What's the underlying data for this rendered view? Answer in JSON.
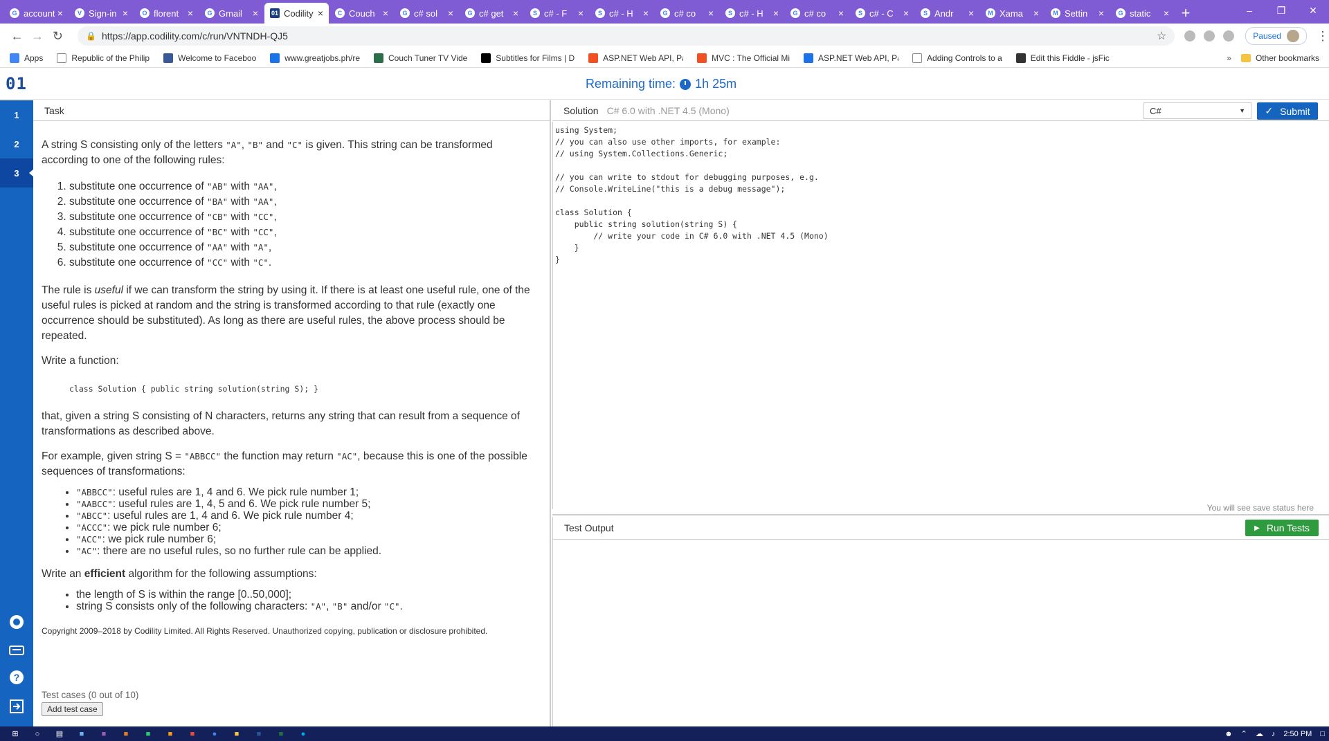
{
  "browser": {
    "tabs": [
      {
        "title": "account",
        "favicon": "G"
      },
      {
        "title": "Sign-in",
        "favicon": "V"
      },
      {
        "title": "florent",
        "favicon": "O"
      },
      {
        "title": "Gmail",
        "favicon": "G"
      },
      {
        "title": "Codility",
        "favicon": "01",
        "active": true
      },
      {
        "title": "Couch",
        "favicon": "C"
      },
      {
        "title": "c# sol",
        "favicon": "G"
      },
      {
        "title": "c# get",
        "favicon": "G"
      },
      {
        "title": "c# - F",
        "favicon": "S"
      },
      {
        "title": "c# - H",
        "favicon": "S"
      },
      {
        "title": "c# co",
        "favicon": "G"
      },
      {
        "title": "c# - H",
        "favicon": "S"
      },
      {
        "title": "c# co",
        "favicon": "G"
      },
      {
        "title": "c# - C",
        "favicon": "S"
      },
      {
        "title": "Andr",
        "favicon": "S"
      },
      {
        "title": "Xama",
        "favicon": "M"
      },
      {
        "title": "Settin",
        "favicon": "M"
      },
      {
        "title": "static",
        "favicon": "G"
      }
    ],
    "tab_close": "×",
    "new_tab": "+",
    "window_controls": {
      "minimize": "–",
      "restore": "❐",
      "close": "✕"
    },
    "nav": {
      "back": "←",
      "forward": "→",
      "reload": "↻"
    },
    "url": "https://app.codility.com/c/run/VNTNDH-QJ5",
    "star": "☆",
    "paused_label": "Paused",
    "menu": "⋮",
    "bookmarks": [
      {
        "label": "Apps",
        "color": "#4285f4"
      },
      {
        "label": "Republic of the Philip",
        "color": "#ffffff"
      },
      {
        "label": "Welcome to Faceboo",
        "color": "#3b5998"
      },
      {
        "label": "www.greatjobs.ph/re",
        "color": "#1a73e8"
      },
      {
        "label": "Couch Tuner TV Vide",
        "color": "#2c6e49"
      },
      {
        "label": "Subtitles for Films | D",
        "color": "#000000"
      },
      {
        "label": "ASP.NET Web API, Pa",
        "color": "#f25022"
      },
      {
        "label": "MVC : The Official Mi",
        "color": "#f25022"
      },
      {
        "label": "ASP.NET Web API, Pa",
        "color": "#1a73e8"
      },
      {
        "label": "Adding Controls to a",
        "color": "#ffffff"
      },
      {
        "label": "Edit this Fiddle - jsFic",
        "color": "#333333"
      }
    ],
    "bookmarks_more": "»",
    "other_bookmarks": "Other bookmarks"
  },
  "header": {
    "logo": "01",
    "remaining_label": "Remaining time:",
    "remaining_value": "1h 25m"
  },
  "sidebar": {
    "tasks": [
      "1",
      "2",
      "3"
    ],
    "active_task": "3"
  },
  "task": {
    "heading": "Task",
    "intro": "A string S consisting only of the letters \"A\", \"B\" and \"C\" is given. This string can be transformed according to one of the following rules:",
    "rules": [
      "substitute one occurrence of \"AB\" with \"AA\",",
      "substitute one occurrence of \"BA\" with \"AA\",",
      "substitute one occurrence of \"CB\" with \"CC\",",
      "substitute one occurrence of \"BC\" with \"CC\",",
      "substitute one occurrence of \"AA\" with \"A\",",
      "substitute one occurrence of \"CC\" with \"C\"."
    ],
    "useful_p1": "The rule is ",
    "useful_word": "useful",
    "useful_p2": " if we can transform the string by using it. If there is at least one useful rule, one of the useful rules is picked at random and the string is transformed according to that rule (exactly one occurrence should be substituted). As long as there are useful rules, the above process should be repeated.",
    "write_function": "Write a function:",
    "signature": "class Solution { public string solution(string S); }",
    "given": "that, given a string S consisting of N characters, returns any string that can result from a sequence of transformations as described above.",
    "example": "For example, given string S = \"ABBCC\" the function may return \"AC\", because this is one of the possible sequences of transformations:",
    "steps": [
      "\"ABBCC\": useful rules are 1, 4 and 6. We pick rule number 1;",
      "\"AABCC\": useful rules are 1, 4, 5 and 6. We pick rule number 5;",
      "\"ABCC\": useful rules are 1, 4 and 6. We pick rule number 4;",
      "\"ACCC\": we pick rule number 6;",
      "\"ACC\": we pick rule number 6;",
      "\"AC\": there are no useful rules, so no further rule can be applied."
    ],
    "efficient_p1": "Write an ",
    "efficient_word": "efficient",
    "efficient_p2": " algorithm for the following assumptions:",
    "assumptions": [
      "the length of S is within the range [0..50,000];",
      "string S consists only of the following characters: \"A\", \"B\" and/or \"C\"."
    ],
    "copyright": "Copyright 2009–2018 by Codility Limited. All Rights Reserved. Unauthorized copying, publication or disclosure prohibited.",
    "test_cases": "Test cases (0 out of 10)",
    "add_test_case": "Add test case"
  },
  "solution": {
    "heading": "Solution",
    "lang_desc": "C# 6.0 with .NET 4.5 (Mono)",
    "lang_select": "C#",
    "submit": "Submit",
    "code": [
      "using System;",
      "// you can also use other imports, for example:",
      "// using System.Collections.Generic;",
      "",
      "// you can write to stdout for debugging purposes, e.g.",
      "// Console.WriteLine(\"this is a debug message\");",
      "",
      "class Solution {",
      "    public string solution(string S) {",
      "        // write your code in C# 6.0 with .NET 4.5 (Mono)",
      "    }",
      "}"
    ],
    "save_status": "You will see save status here"
  },
  "output": {
    "heading": "Test Output",
    "run_tests": "Run Tests"
  },
  "taskbar": {
    "time": "2:50 PM"
  },
  "colors": {
    "tab_strip": "#7f5bd4",
    "codility_blue": "#1565c0",
    "run_green": "#2e9b3e",
    "taskbar": "#14205a"
  }
}
